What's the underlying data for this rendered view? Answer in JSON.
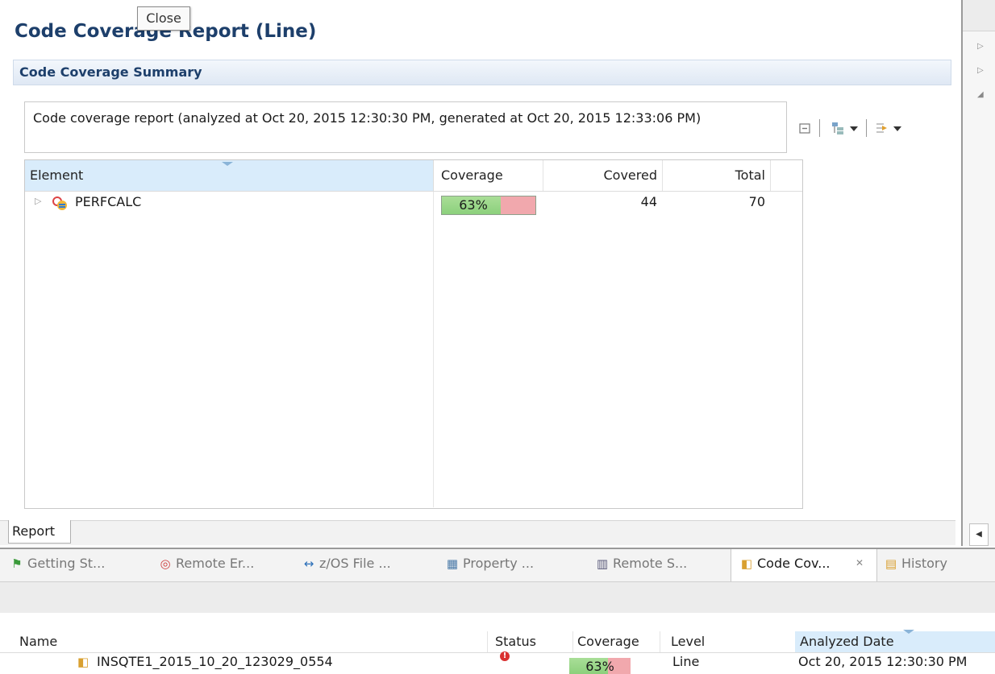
{
  "tooltip": "Close",
  "report": {
    "title": "Code Coverage Report (Line)",
    "summary_title": "Code Coverage Summary",
    "description": "Code coverage report (analyzed at Oct 20, 2015 12:30:30 PM, generated at Oct 20, 2015 12:33:06 PM)",
    "tab": "Report"
  },
  "table": {
    "columns": [
      "Element",
      "Coverage",
      "Covered",
      "Total"
    ],
    "rows": [
      {
        "name": "PERFCALC",
        "coverage_label": "63%",
        "coverage_fraction": 0.63,
        "covered": "44",
        "total": "70"
      }
    ]
  },
  "views": {
    "tabs": [
      {
        "label": "Getting St...",
        "icon": "flag-icon"
      },
      {
        "label": "Remote Er...",
        "icon": "remote-error-icon"
      },
      {
        "label": "z/OS File ...",
        "icon": "zos-file-icon"
      },
      {
        "label": "Property ...",
        "icon": "property-icon"
      },
      {
        "label": "Remote S...",
        "icon": "remote-systems-icon"
      },
      {
        "label": "Code Cov...",
        "icon": "code-coverage-icon",
        "active": true
      },
      {
        "label": "History",
        "icon": "history-icon"
      }
    ]
  },
  "results": {
    "columns": [
      "Name",
      "Status",
      "Coverage",
      "Level",
      "Analyzed Date"
    ],
    "rows": [
      {
        "name": "INSQTE1_2015_10_20_123029_0554",
        "status": "error",
        "coverage_label": "63%",
        "coverage_fraction": 0.63,
        "level": "Line",
        "analyzed_date": "Oct 20, 2015 12:30:30 PM"
      }
    ]
  },
  "colors": {
    "title": "#1d3f6b",
    "coverage_covered": "#8cd07c",
    "coverage_uncovered": "#f1a8ad",
    "selected_header": "#d9ecfb"
  }
}
